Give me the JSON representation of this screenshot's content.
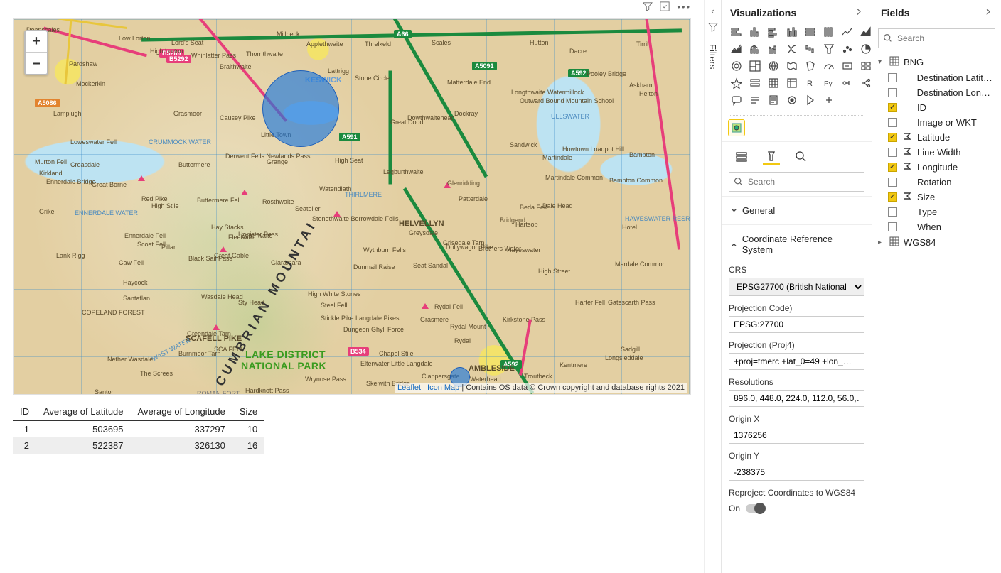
{
  "visual_toolbar": {
    "filter_tip": "Filters",
    "focus_tip": "Focus mode",
    "more_tip": "More options"
  },
  "map": {
    "zoom_in": "+",
    "zoom_out": "–",
    "attribution": {
      "leaflet": "Leaflet",
      "sep": " | ",
      "iconmap": "Icon Map",
      "suffix": " | Contains OS data © Crown copyright and database rights 2021"
    },
    "park_label_1": "LAKE DISTRICT",
    "park_label_2": "NATIONAL PARK",
    "mountain_label": "CUMBRIAN  MOUNTAI",
    "helvellyn": "HELVELLYN",
    "roads": {
      "a66": "A66",
      "a591": "A591",
      "a592": "A592",
      "a5091": "A5091",
      "a5086": "A5086",
      "b5289": "B5289",
      "b5292": "B5292",
      "b534": "B534"
    },
    "places": {
      "keswick": "KESWICK",
      "ambleside": "AMBLESIDE",
      "scafell": "SCAFELL PIKE",
      "deanscales": "Deanscales",
      "low_lorton": "Low Lorton",
      "high_lorton": "High Lorton",
      "lords_seat": "Lord's Seat",
      "millbeck": "Millbeck",
      "applethwaite": "Applethwaite",
      "threlkeld": "Threlkeld",
      "scales": "Scales",
      "hutton": "Hutton",
      "dacre": "Dacre",
      "tirril": "Tirril",
      "pardshaw": "Pardshaw",
      "whinlatter": "Whinlatter Pass",
      "lattrigg": "Lattrigg",
      "matterdale": "Matterdale End",
      "mockerkin": "Mockerkin",
      "braithwaite": "Braithwaite",
      "thornthwaite": "Thornthwaite",
      "stone_circle": "Stone Circle",
      "pooley": "Pooley Bridge",
      "askham": "Askham",
      "lamplugh": "Lamplugh",
      "grasmoor": "Grasmoor",
      "causey": "Causey Pike",
      "little_town": "Little Town",
      "great_dodd": "Great Dodd",
      "dockray": "Dockray",
      "watermillock": "Longthwaite Watermillock",
      "outward": "Outward Bound Mountain School",
      "helton": "Helton",
      "loweswater": "Loweswater Fell",
      "crummock": "CRUMMOCK WATER",
      "dowthwaite": "Dowthwaitehead",
      "ullswater": "ULLSWATER",
      "murton": "Murton Fell",
      "croasdale": "Croasdale",
      "kirkland": "Kirkland",
      "ennerdale_br": "Ennerdale Bridge",
      "buttermere": "Buttermere",
      "derwent_fells": "Derwent Fells Newlands Pass",
      "grange": "Grange",
      "high_seat": "High Seat",
      "legburthwaite": "Legburthwaite",
      "sandwick": "Sandwick",
      "martindale": "Martindale",
      "howtown": "Howtown Loadpot Hill",
      "bampton": "Bampton",
      "great_borne": "Great Borne",
      "red_pike": "Red Pike",
      "high_stile": "High Stile",
      "buttermere_fell": "Buttermere Fell",
      "rosthwaite": "Rosthwaite",
      "seatoller": "Seatoller",
      "watendlath": "Watendlath",
      "thirlmere": "THIRLMERE",
      "glenridding": "Glenridding",
      "patterdale": "Patterdale",
      "martindale_c": "Martindale Common",
      "bampton_c": "Bampton Common",
      "grike": "Grike",
      "ennerdale_f": "Ennerdale Fell",
      "ennerdale_w": "ENNERDALE WATER",
      "pillar": "Pillar",
      "haystacks": "Hay Stacks",
      "honister": "Honister Pass",
      "seathwaite": "Seathwaite",
      "stonethwaite": "Stonethwaite Borrowdale Fells",
      "greysdale": "Greysdale",
      "grisedale": "Grisedale Tarn",
      "bridgend": "Bridgend",
      "beda": "Beda Fell",
      "dale_head": "Dale Head",
      "hartsop": "Hartsop",
      "haweswater": "HAWESWATER RESR",
      "lank_rigg": "Lank Rigg",
      "caw_fell": "Caw Fell",
      "scoat": "Scoat Fell",
      "black_sail": "Black Sail Pass",
      "great_gable": "Great Gable",
      "glaramara": "Glaramara",
      "wythburn": "Wythburn Fells",
      "dunmail": "Dunmail Raise",
      "seat_sandal": "Seat Sandal",
      "dollywagon": "Dollywagon Pike",
      "brothers": "Brothers Water",
      "hayeswater": "Hayeswater",
      "high_street": "High Street",
      "mardale": "Mardale Common",
      "copeland": "COPELAND FOREST",
      "santaflan": "Santaflan",
      "haycock": "Haycock",
      "wasdale_h": "Wasdale Head",
      "sty_head": "Sty Head",
      "high_white": "High White Stones",
      "steel_fell": "Steel Fell",
      "rydal_fell": "Rydal Fell",
      "kirkstone": "Kirkstone Pass",
      "harter": "Harter Fell",
      "gatescarth": "Gatescarth Pass",
      "nether_w": "Nether Wasdale",
      "burnmoor": "Burnmoor Tarn",
      "sca_fell": "SCA FELL",
      "stickle": "Stickle Pike Langdale Pikes",
      "dungeon": "Dungeon Ghyll Force",
      "grasmere": "Grasmere",
      "rydal_mount": "Rydal Mount",
      "rydal": "Rydal",
      "hotel": "Hotel",
      "wast_water": "WAST WATER",
      "the_screes": "The Screes",
      "chapel_stile": "Chapel Stile",
      "elterwater": "Elterwater Little Langdale",
      "clappersgate": "Clappersgate",
      "waterhead": "Waterhead",
      "troutbeck": "Troutbeck",
      "kentmere": "Kentmere",
      "longsleddale": "Longsleddale",
      "sadgill": "Sadgill",
      "wrynose": "Wrynose Pass",
      "skelwith": "Skelwith Bridge",
      "santon": "Santon",
      "roman_fort": "ROMAN FORT",
      "hardknott": "Hardknott Pass",
      "greendale": "Greendale Tarn",
      "fleetwith": "Fleetwith"
    }
  },
  "table": {
    "headers": [
      "ID",
      "Average of Latitude",
      "Average of Longitude",
      "Size"
    ],
    "rows": [
      {
        "id": "1",
        "lat": "503695",
        "lon": "337297",
        "size": "10"
      },
      {
        "id": "2",
        "lat": "522387",
        "lon": "326130",
        "size": "16"
      }
    ]
  },
  "filters_tab": {
    "label": "Filters"
  },
  "viz_panel": {
    "title": "Visualizations",
    "format_search_placeholder": "Search",
    "sections": {
      "general": "General",
      "crs": "Coordinate Reference System"
    },
    "fields": {
      "crs_label": "CRS",
      "crs_value": "EPSG27700 (British National …",
      "proj_code_label": "Projection Code)",
      "proj_code_value": "EPSG:27700",
      "proj4_label": "Projection (Proj4)",
      "proj4_value": "+proj=tmerc +lat_0=49 +lon_…",
      "res_label": "Resolutions",
      "res_value": "896.0, 448.0, 224.0, 112.0, 56.0,…",
      "ox_label": "Origin X",
      "ox_value": "1376256",
      "oy_label": "Origin Y",
      "oy_value": "-238375",
      "reproj_label": "Reproject Coordinates to WGS84",
      "reproj_state": "On"
    }
  },
  "fields_panel": {
    "title": "Fields",
    "search_placeholder": "Search",
    "tables": [
      {
        "name": "BNG",
        "expanded": true,
        "fields": [
          {
            "name": "Destination Latitu…",
            "checked": false,
            "agg": false
          },
          {
            "name": "Destination Longi…",
            "checked": false,
            "agg": false
          },
          {
            "name": "ID",
            "checked": true,
            "agg": false
          },
          {
            "name": "Image or WKT",
            "checked": false,
            "agg": false
          },
          {
            "name": "Latitude",
            "checked": true,
            "agg": true
          },
          {
            "name": "Line Width",
            "checked": false,
            "agg": true
          },
          {
            "name": "Longitude",
            "checked": true,
            "agg": true
          },
          {
            "name": "Rotation",
            "checked": false,
            "agg": false
          },
          {
            "name": "Size",
            "checked": true,
            "agg": true
          },
          {
            "name": "Type",
            "checked": false,
            "agg": false
          },
          {
            "name": "When",
            "checked": false,
            "agg": false
          }
        ]
      },
      {
        "name": "WGS84",
        "expanded": false,
        "fields": []
      }
    ]
  }
}
